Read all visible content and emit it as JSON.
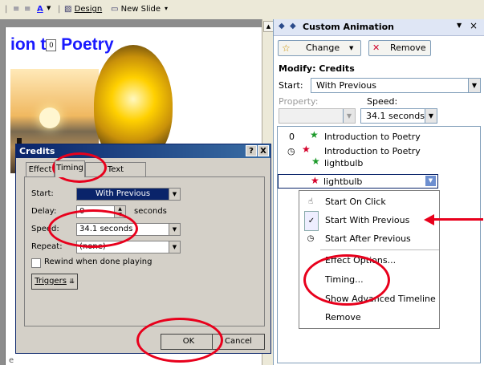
{
  "toolbar": {
    "font_color_label": "A",
    "design_label": "Design",
    "new_slide_label": "New Slide"
  },
  "slide": {
    "title_visible": "ion t",
    "title_end": " Poetry",
    "placeholder_badge": "0",
    "bottom_text": "e"
  },
  "task_pane": {
    "title": "Custom Animation",
    "change_label": "Change",
    "remove_label": "Remove",
    "modify_heading": "Modify: Credits",
    "start_label": "Start:",
    "start_value": "With Previous",
    "property_label": "Property:",
    "speed_label": "Speed:",
    "speed_value": "34.1 seconds",
    "list": [
      {
        "num": "0",
        "label": "Introduction to Poetry"
      },
      {
        "num": "",
        "label": "Introduction to Poetry"
      },
      {
        "num": "",
        "label": "lightbulb"
      },
      {
        "num": "",
        "label": "lightbulb"
      }
    ]
  },
  "context_menu": {
    "items": [
      {
        "label": "Start On Click",
        "icon": "mouse-click-icon"
      },
      {
        "label": "Start With Previous",
        "icon": "checkmark-icon"
      },
      {
        "label": "Start After Previous",
        "icon": "clock-icon"
      },
      {
        "label": "Effect Options...",
        "icon": ""
      },
      {
        "label": "Timing...",
        "icon": ""
      },
      {
        "label": "Show Advanced Timeline",
        "icon": ""
      },
      {
        "label": "Remove",
        "icon": ""
      }
    ]
  },
  "dialog": {
    "title": "Credits",
    "help": "?",
    "close": "X",
    "tabs": [
      "Effect",
      "Timing",
      "Text Animation"
    ],
    "start_label": "Start:",
    "start_value": "With Previous",
    "delay_label": "Delay:",
    "delay_value": "0",
    "delay_unit": "seconds",
    "speed_label": "Speed:",
    "speed_value": "34.1 seconds",
    "repeat_label": "Repeat:",
    "repeat_value": "(none)",
    "rewind_label": "Rewind when done playing",
    "triggers_label": "Triggers",
    "ok_label": "OK",
    "cancel_label": "Cancel"
  },
  "colors": {
    "annotation": "#e8001c",
    "slide_title": "#1a1aff",
    "selection": "#0a246a"
  }
}
